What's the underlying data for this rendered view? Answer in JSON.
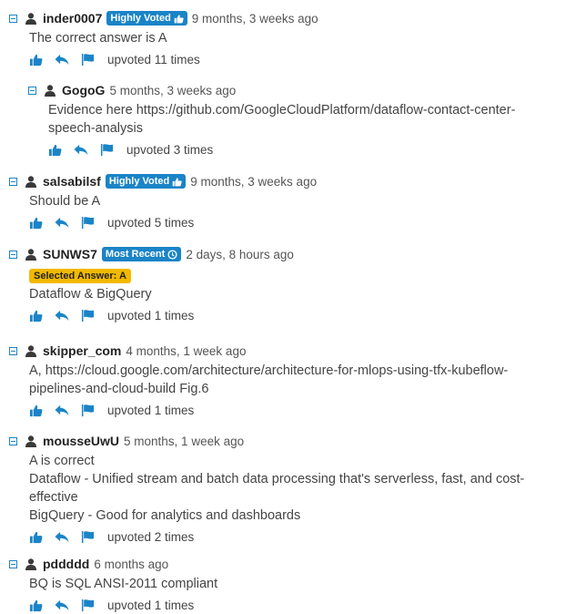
{
  "colors": {
    "accent": "#1a84c7",
    "selected_bg": "#f2b900"
  },
  "comments": [
    {
      "user": "inder0007",
      "badge": "Highly Voted",
      "badge_icon": "thumbs-up-icon",
      "time": "9 months, 3 weeks ago",
      "lines": [
        "The correct answer is A"
      ],
      "upvotes": "upvoted 11 times"
    },
    {
      "user": "GogoG",
      "badge": "",
      "time": "5 months, 3 weeks ago",
      "lines": [
        "Evidence here https://github.com/GoogleCloudPlatform/dataflow-contact-center-",
        "speech-analysis"
      ],
      "upvotes": "upvoted 3 times"
    },
    {
      "user": "salsabilsf",
      "badge": "Highly Voted",
      "badge_icon": "thumbs-up-icon",
      "time": "9 months, 3 weeks ago",
      "lines": [
        "Should be A"
      ],
      "upvotes": "upvoted 5 times"
    },
    {
      "user": "SUNWS7",
      "badge": "Most Recent",
      "badge_icon": "clock-icon",
      "time": "2 days, 8 hours ago",
      "selected": "Selected Answer: A",
      "lines": [
        "Dataflow & BigQuery"
      ],
      "upvotes": "upvoted 1 times"
    },
    {
      "user": "skipper_com",
      "badge": "",
      "time": "4 months, 1 week ago",
      "lines": [
        "A, https://cloud.google.com/architecture/architecture-for-mlops-using-tfx-kubeflow-",
        "pipelines-and-cloud-build Fig.6"
      ],
      "upvotes": "upvoted 1 times"
    },
    {
      "user": "mousseUwU",
      "badge": "",
      "time": "5 months, 1 week ago",
      "lines": [
        "A is correct",
        "Dataflow - Unified stream and batch data processing that's serverless, fast, and cost-",
        "effective",
        "BigQuery - Good for analytics and dashboards"
      ],
      "upvotes": "upvoted 2 times"
    },
    {
      "user": "pddddd",
      "badge": "",
      "time": "6 months ago",
      "lines": [
        "BQ is SQL ANSI-2011 compliant"
      ],
      "upvotes": "upvoted 1 times"
    }
  ]
}
